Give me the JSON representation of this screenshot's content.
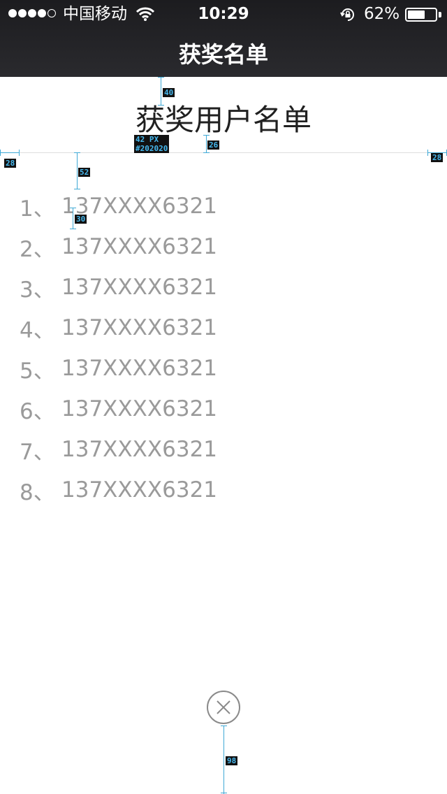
{
  "status_bar": {
    "signal_icon": "signal-dots-icon",
    "carrier": "中国移动",
    "wifi_icon": "wifi-icon",
    "time": "10:29",
    "rotation_lock_icon": "rotation-lock-icon",
    "battery_text": "62%",
    "battery_level": 0.62
  },
  "nav": {
    "title": "获奖名单"
  },
  "main": {
    "heading": "获奖用户名单",
    "winners": [
      {
        "index": "1、",
        "phone": "137XXXX6321"
      },
      {
        "index": "2、",
        "phone": "137XXXX6321"
      },
      {
        "index": "3、",
        "phone": "137XXXX6321"
      },
      {
        "index": "4、",
        "phone": "137XXXX6321"
      },
      {
        "index": "5、",
        "phone": "137XXXX6321"
      },
      {
        "index": "6、",
        "phone": "137XXXX6321"
      },
      {
        "index": "7、",
        "phone": "137XXXX6321"
      },
      {
        "index": "8、",
        "phone": "137XXXX6321"
      }
    ],
    "close_icon": "close-circle-icon"
  },
  "annotations": {
    "top_gap": "40",
    "title_font_size": "42 PX",
    "title_color": "#202020",
    "title_bottom_gap": "26",
    "left_margin": "28",
    "right_margin": "28",
    "list_top_gap": "52",
    "row_gap": "30",
    "close_bottom_gap": "98"
  },
  "colors": {
    "title_text": "#202020",
    "list_text": "#9a9a9a",
    "nav_bg": "#1c1c1f",
    "annotation": "#46b8ee"
  }
}
